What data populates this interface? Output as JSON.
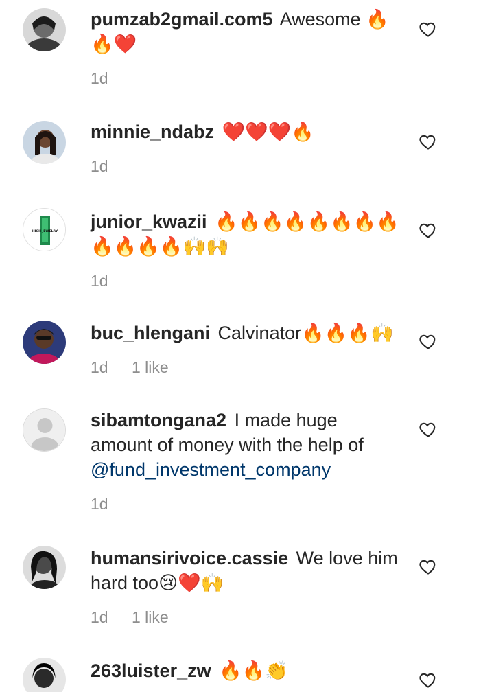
{
  "comments": [
    {
      "username": "pumzab2gmail.com5",
      "text": "Awesome 🔥🔥❤️",
      "time": "1d",
      "likes": ""
    },
    {
      "username": "minnie_ndabz",
      "text": "❤️❤️❤️🔥",
      "time": "1d",
      "likes": ""
    },
    {
      "username": "junior_kwazii",
      "text": "🔥🔥🔥🔥🔥🔥🔥🔥🔥🔥🔥🔥🙌🙌",
      "time": "1d",
      "likes": ""
    },
    {
      "username": "buc_hlengani",
      "text": "Calvinator🔥🔥🔥🙌",
      "time": "1d",
      "likes": "1 like"
    },
    {
      "username": "sibamtongana2",
      "text": "I made huge amount of money with the help of",
      "mention": "@fund_investment_company",
      "time": "1d",
      "likes": ""
    },
    {
      "username": "humansirivoice.cassie",
      "text": "We love him hard too😢❤️🙌",
      "time": "1d",
      "likes": "1 like"
    },
    {
      "username": "263luister_zw",
      "text": "🔥🔥👏",
      "time": "",
      "likes": ""
    }
  ],
  "avatar_texts": {
    "junior_kwazii": "HIGH JEWELRY"
  }
}
